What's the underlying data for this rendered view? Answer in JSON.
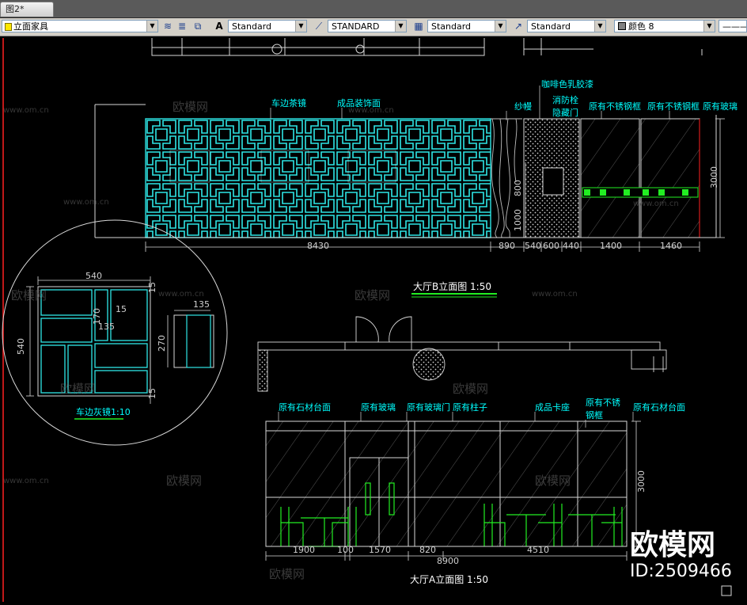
{
  "window": {
    "tab_title": "图2*"
  },
  "toolbar": {
    "layer": "立面家具",
    "text_style": "Standard",
    "dim_style": "STANDARD",
    "table_style": "Standard",
    "multileader_style": "Standard",
    "color_label": "颜色 8",
    "linetype": "———"
  },
  "drawing": {
    "elevation_b": {
      "title": "大厅B立面图 1:50",
      "labels": {
        "mirror": "车边茶镜",
        "decor_panel": "成品装饰面",
        "gauze": "纱幔",
        "latex": "咖啡色乳胶漆",
        "fire_hydrant": "消防栓",
        "hidden_door": "隐藏门",
        "steel_frame_1": "原有不锈钢框",
        "steel_frame_2": "原有不锈钢框",
        "glass": "原有玻璃"
      },
      "dims": {
        "w1": "8430",
        "w2": "890",
        "w3": "540",
        "w4": "600",
        "w5": "440",
        "w6": "1400",
        "w7": "1460",
        "h_total": "3000",
        "h1": "800",
        "h2": "1000"
      }
    },
    "detail": {
      "title": "车边灰镜1:10",
      "dims": {
        "top": "540",
        "left": "540",
        "d170": "170",
        "d15a": "15",
        "d135a": "135",
        "d15b": "15",
        "d15c": "15",
        "side_w": "135",
        "side_h": "270"
      }
    },
    "elevation_a": {
      "title": "大厅A立面图 1:50",
      "labels": {
        "stone_1": "原有石材台面",
        "glass": "原有玻璃",
        "glass_door": "原有玻璃门",
        "column": "原有柱子",
        "booth": "成品卡座",
        "steel_frame_1": "原有不锈",
        "steel_frame_2": "钢框",
        "stone_2": "原有石材台面"
      },
      "dims": {
        "d1": "1900",
        "d2": "100",
        "d3": "1570",
        "d4": "820",
        "d5": "4510",
        "total": "8900",
        "height": "3000"
      }
    },
    "watermark": {
      "brand": "欧模网",
      "site": "www.om.cn",
      "id": "ID:2509466"
    }
  },
  "colors": {
    "accent": "#00ffff",
    "lines": "#dddddd",
    "panel": "#2ee6e6",
    "highlight": "#22ee22",
    "background": "#000000"
  }
}
